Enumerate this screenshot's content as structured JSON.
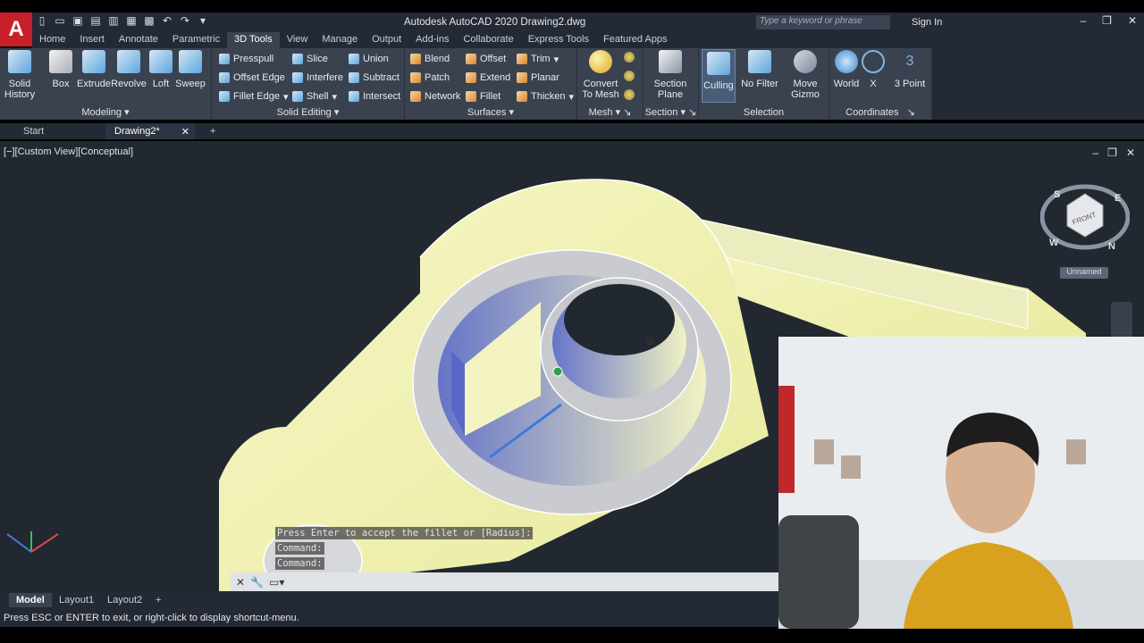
{
  "app": {
    "logo": "A",
    "title": "Autodesk AutoCAD 2020    Drawing2.dwg",
    "search_placeholder": "Type a keyword or phrase",
    "signin": "Sign In"
  },
  "menu_tabs": [
    "Home",
    "Insert",
    "Annotate",
    "Parametric",
    "3D Tools",
    "View",
    "Manage",
    "Output",
    "Add-ins",
    "Collaborate",
    "Express Tools",
    "Featured Apps"
  ],
  "ribbon": {
    "modeling": {
      "label": "Modeling",
      "buttons": [
        "Solid History",
        "Box",
        "Extrude",
        "Revolve",
        "Loft",
        "Sweep"
      ]
    },
    "solid_editing": {
      "label": "Solid Editing",
      "col1": [
        "Presspull",
        "Offset Edge",
        "Fillet Edge"
      ],
      "col2": [
        "Slice",
        "Interfere",
        "Shell"
      ],
      "col3": [
        "Union",
        "Subtract",
        "Intersect"
      ]
    },
    "surfaces": {
      "label": "Surfaces",
      "col1": [
        "Blend",
        "Patch",
        "Network"
      ],
      "col2": [
        "Offset",
        "Extend",
        "Fillet"
      ],
      "col3": [
        "Trim",
        "Planar",
        "Thicken"
      ]
    },
    "mesh": {
      "label": "Mesh",
      "button": "Convert To Mesh"
    },
    "section": {
      "label": "Section",
      "button": "Section Plane"
    },
    "selection": {
      "label": "Selection",
      "buttons": [
        "Culling",
        "No Filter",
        "Move Gizmo"
      ]
    },
    "coordinates": {
      "label": "Coordinates",
      "buttons": [
        "World",
        "X",
        "3 Point"
      ]
    }
  },
  "doc_tabs": {
    "start": "Start",
    "drawing": "Drawing2*"
  },
  "viewport": {
    "label": "[−][Custom View][Conceptual]",
    "nav_cube_face": "FRONT",
    "compass": [
      "S",
      "E",
      "W",
      "N"
    ],
    "view_name": "Unnamed"
  },
  "command_history": [
    "Press Enter to accept the fillet or [Radius]:",
    "Command:",
    "Command:"
  ],
  "layout_tabs": [
    "Model",
    "Layout1",
    "Layout2"
  ],
  "status_text": "Press ESC or ENTER to exit, or right-click to display shortcut-menu."
}
